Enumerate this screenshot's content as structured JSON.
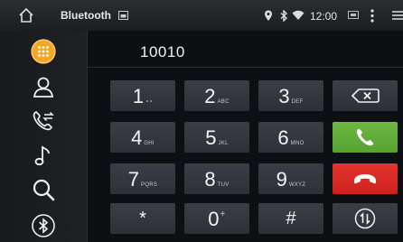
{
  "statusbar": {
    "title": "Bluetooth",
    "time": "12:00"
  },
  "sidebar": {
    "items": [
      {
        "name": "dialpad",
        "icon": "dialpad-icon",
        "active": true
      },
      {
        "name": "contacts",
        "icon": "contact-person-icon"
      },
      {
        "name": "call-log",
        "icon": "call-log-icon"
      },
      {
        "name": "music",
        "icon": "music-note-icon"
      },
      {
        "name": "search",
        "icon": "search-icon"
      },
      {
        "name": "bluetooth-settings",
        "icon": "bluetooth-icon"
      }
    ]
  },
  "dialer": {
    "number": "10010"
  },
  "keypad": {
    "keys": [
      {
        "digit": "1",
        "sub": "∘∘"
      },
      {
        "digit": "2",
        "sub": "ABC"
      },
      {
        "digit": "3",
        "sub": "DEF"
      },
      {
        "digit": "4",
        "sub": "GHI"
      },
      {
        "digit": "5",
        "sub": "JKL"
      },
      {
        "digit": "6",
        "sub": "MNO"
      },
      {
        "digit": "7",
        "sub": "PQRS"
      },
      {
        "digit": "8",
        "sub": "TUV"
      },
      {
        "digit": "9",
        "sub": "WXYZ"
      },
      {
        "digit": "*",
        "sub": ""
      },
      {
        "digit": "0",
        "sub": "+"
      },
      {
        "digit": "#",
        "sub": ""
      }
    ]
  },
  "colors": {
    "accent": "#f5a623",
    "call": "#62ad3a",
    "hangup": "#d92a24"
  }
}
